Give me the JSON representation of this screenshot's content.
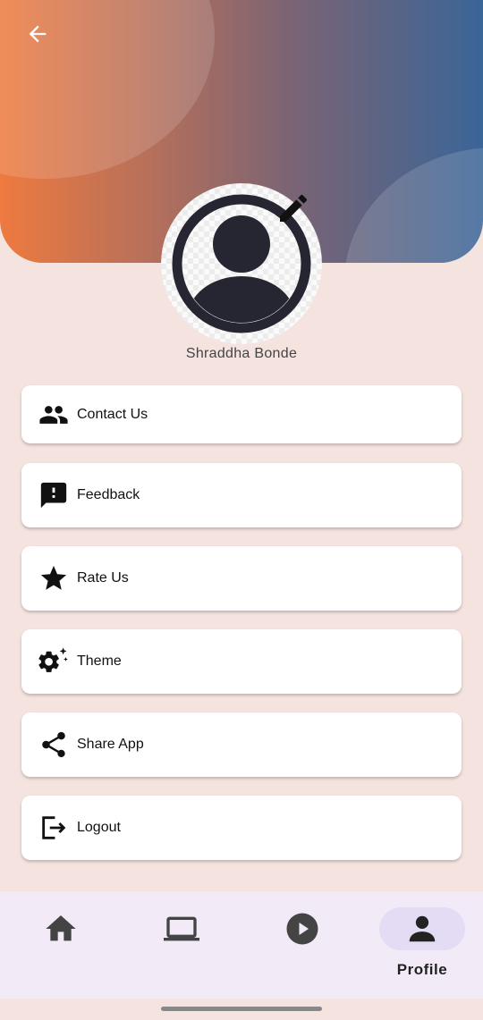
{
  "header": {
    "back_icon": "arrow-left-icon",
    "gradient_colors": [
      "#ee7a3f",
      "#3a6597"
    ]
  },
  "profile": {
    "name": "Shraddha Bonde",
    "avatar_icon": "person-avatar-icon",
    "edit_icon": "pencil-icon"
  },
  "menu": [
    {
      "label": "Contact Us",
      "icon": "people-icon"
    },
    {
      "label": "Feedback",
      "icon": "feedback-icon"
    },
    {
      "label": "Rate Us",
      "icon": "star-icon"
    },
    {
      "label": "Theme",
      "icon": "gear-sparkle-icon"
    },
    {
      "label": "Share App",
      "icon": "share-icon"
    },
    {
      "label": "Logout",
      "icon": "logout-icon"
    }
  ],
  "bottom_nav": {
    "items": [
      {
        "icon": "home-icon",
        "label": ""
      },
      {
        "icon": "laptop-icon",
        "label": ""
      },
      {
        "icon": "play-icon",
        "label": ""
      },
      {
        "icon": "person-icon",
        "label": "Profile",
        "active": true
      }
    ],
    "active_color": "#e4dcf4"
  }
}
